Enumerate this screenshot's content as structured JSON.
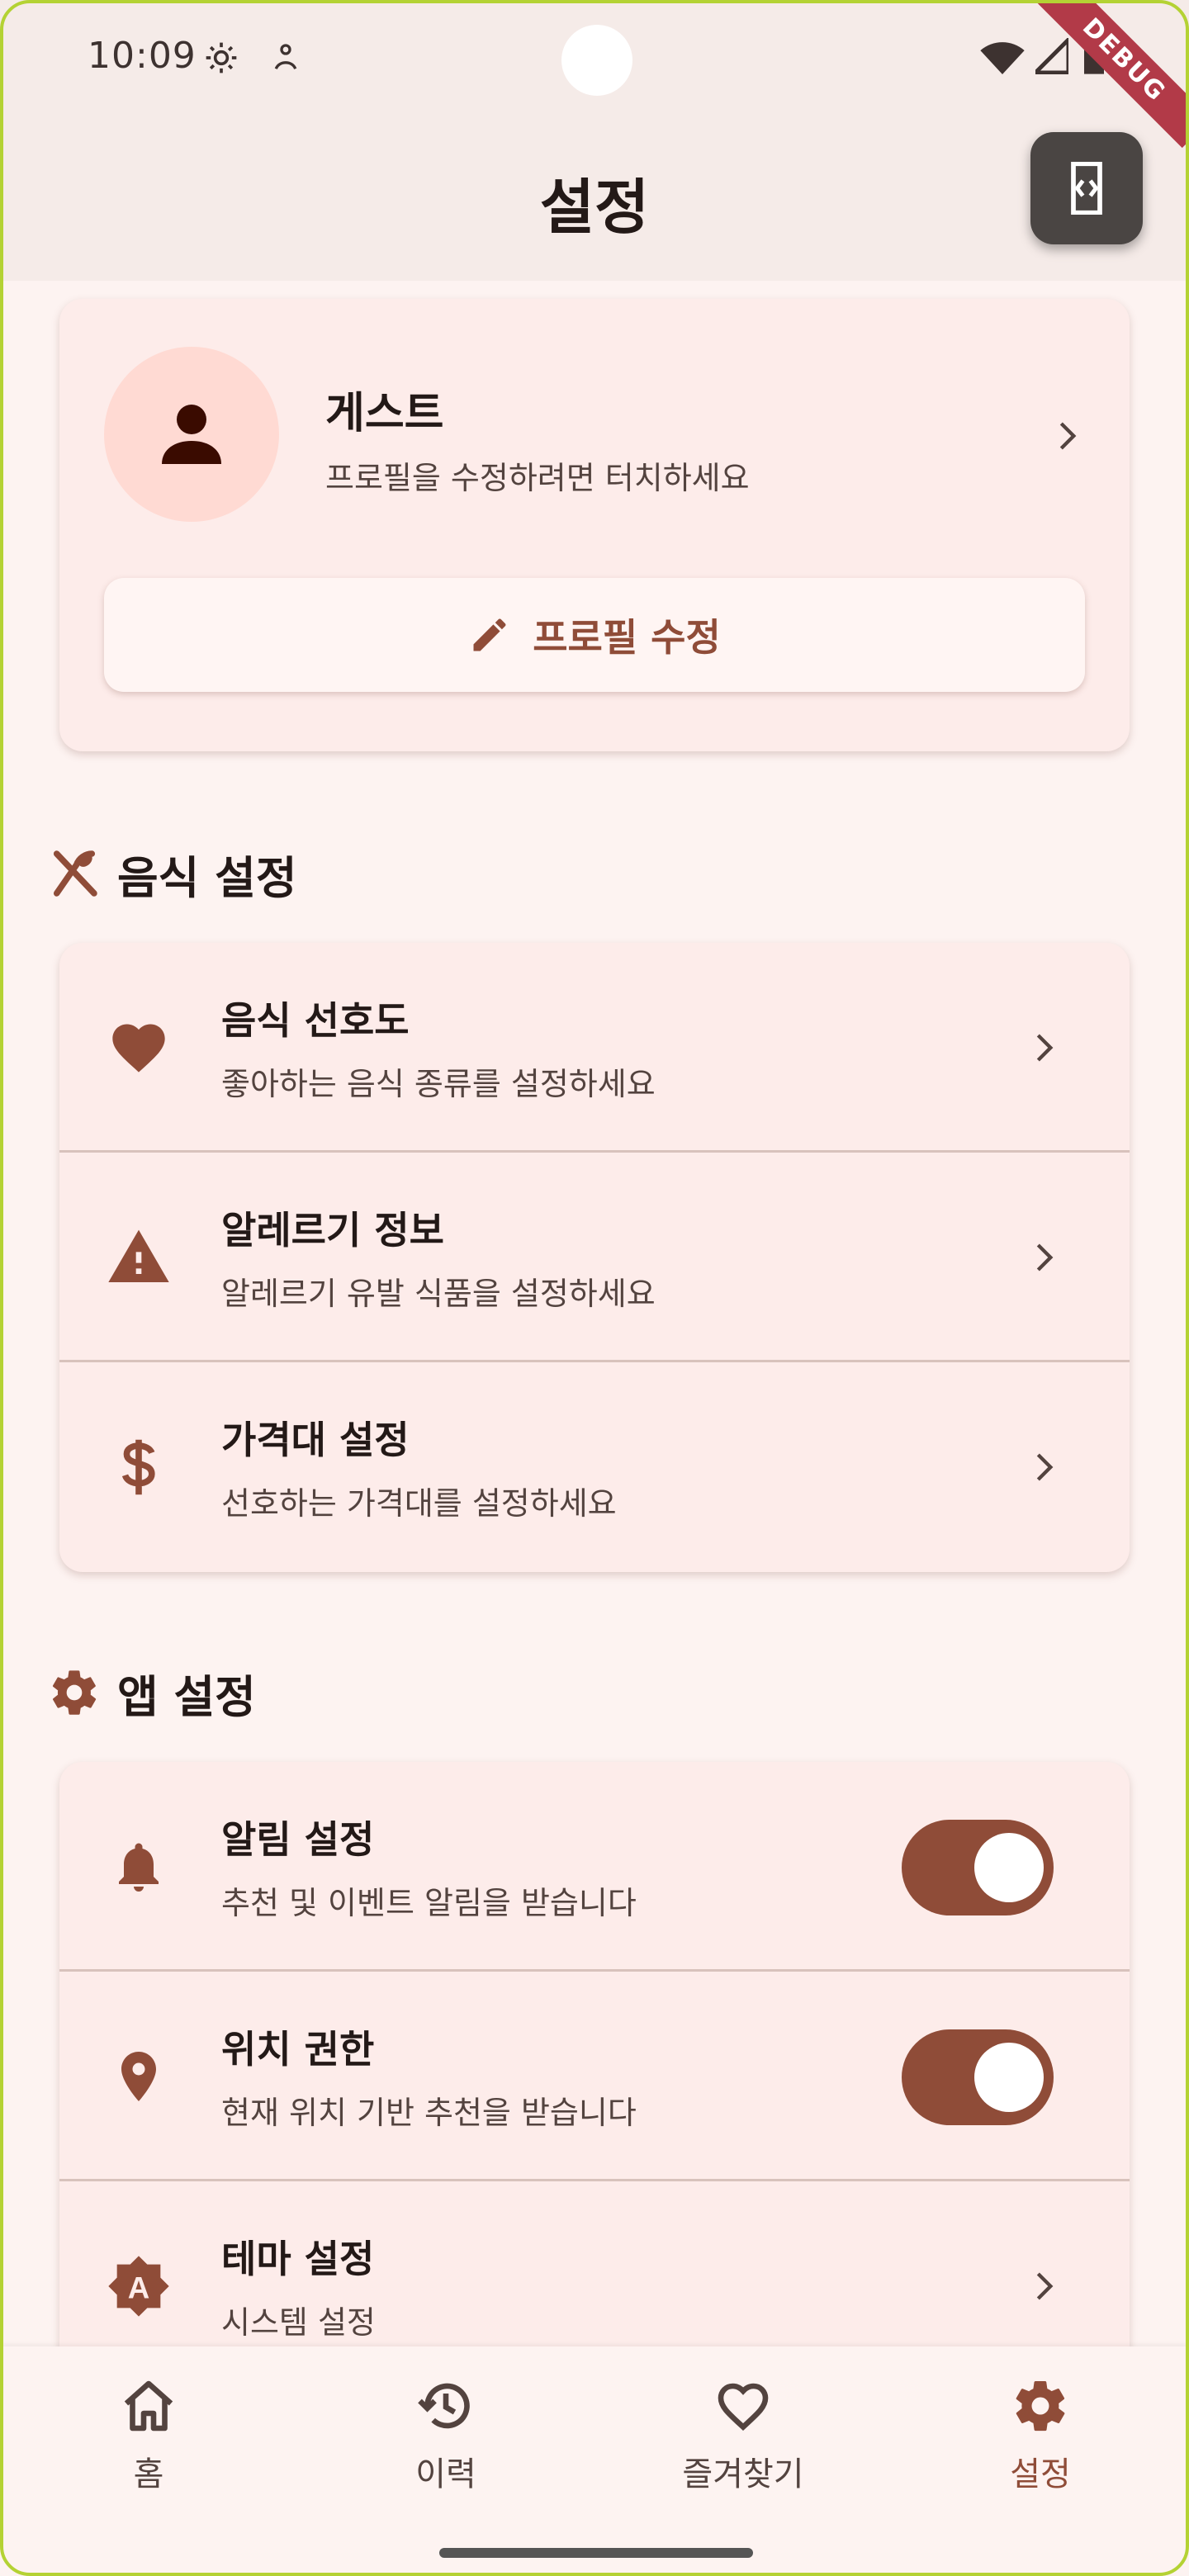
{
  "status_bar": {
    "time": "10:09"
  },
  "debug_ribbon": "DEBUG",
  "app_bar": {
    "title": "설정"
  },
  "profile": {
    "name": "게스트",
    "subtitle": "프로필을 수정하려면 터치하세요",
    "edit_button_label": "프로필 수정"
  },
  "food_settings": {
    "title": "음식 설정",
    "items": [
      {
        "icon": "heart-icon",
        "title": "음식 선호도",
        "subtitle": "좋아하는 음식 종류를 설정하세요"
      },
      {
        "icon": "warning-icon",
        "title": "알레르기 정보",
        "subtitle": "알레르기 유발 식품을 설정하세요"
      },
      {
        "icon": "dollar-icon",
        "title": "가격대 설정",
        "subtitle": "선호하는 가격대를 설정하세요"
      }
    ]
  },
  "app_settings": {
    "title": "앱 설정",
    "items": [
      {
        "icon": "bell-icon",
        "title": "알림 설정",
        "subtitle": "추천 및 이벤트 알림을 받습니다",
        "toggle": true
      },
      {
        "icon": "location-pin-icon",
        "title": "위치 권한",
        "subtitle": "현재 위치 기반 추천을 받습니다",
        "toggle": true
      },
      {
        "icon": "theme-icon",
        "title": "테마 설정",
        "subtitle": "시스템 설정"
      }
    ]
  },
  "bottom_nav": [
    {
      "icon": "home-icon",
      "label": "홈"
    },
    {
      "icon": "history-icon",
      "label": "이력"
    },
    {
      "icon": "heart-outline-icon",
      "label": "즐겨찾기"
    },
    {
      "icon": "gear-icon",
      "label": "설정",
      "active": true
    }
  ],
  "colors": {
    "primary": "#8f4c38",
    "background": "#fdf3f1",
    "card": "#fdecea",
    "app_bar": "#f5ebe8",
    "avatar_bg": "#ffdad3"
  }
}
